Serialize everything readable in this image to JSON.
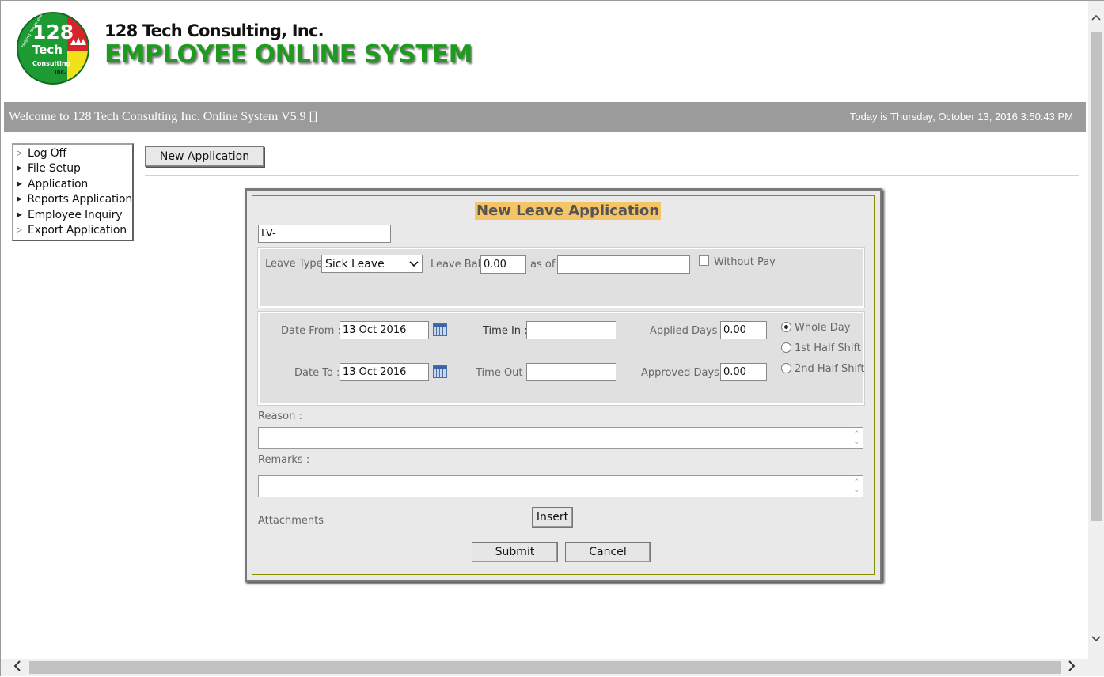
{
  "header": {
    "logo_text_main": "128",
    "logo_text_tech": "Tech",
    "logo_text_consulting": "Consulting",
    "logo_text_inc": "Inc.",
    "logo_tagline": "Helping You Innovate",
    "company_name": "128 Tech Consulting, Inc.",
    "system_name": "EMPLOYEE ONLINE SYSTEM"
  },
  "welcome_bar": {
    "welcome_text": "Welcome to 128 Tech Consulting Inc. Online System V5.9 []",
    "today_text": "Today is Thursday, October 13, 2016 3:50:43 PM"
  },
  "sidebar": {
    "items": [
      {
        "label": "Log Off",
        "marker": "▷"
      },
      {
        "label": "File Setup",
        "marker": "▶"
      },
      {
        "label": "Application",
        "marker": "▶"
      },
      {
        "label": "Reports Application",
        "marker": "▶"
      },
      {
        "label": "Employee Inquiry",
        "marker": "▶"
      },
      {
        "label": "Export Application",
        "marker": "▷"
      }
    ]
  },
  "toolbar": {
    "new_application_label": "New Application"
  },
  "form": {
    "title": "New Leave Application",
    "application_no": "LV-",
    "leave_type_label": "Leave Type",
    "leave_type_value": "Sick Leave",
    "leave_bal_label": "Leave Bal",
    "leave_bal_value": "0.00",
    "as_of_label": "as of",
    "as_of_value": "",
    "without_pay_label": "Without Pay",
    "date_from_label": "Date From :",
    "date_from_value": "13 Oct 2016",
    "date_to_label": "Date To :",
    "date_to_value": "13 Oct 2016",
    "time_in_label": "Time In :",
    "time_in_value": "",
    "time_out_label": "Time Out :",
    "time_out_value": "",
    "applied_days_label": "Applied Days :",
    "applied_days_value": "0.00",
    "approved_days_label": "Approved Days :",
    "approved_days_value": "0.00",
    "shift_options": [
      "Whole Day",
      "1st Half Shift",
      "2nd Half Shift"
    ],
    "reason_label": "Reason :",
    "remarks_label": "Remarks :",
    "attachments_label": "Attachments",
    "insert_label": "Insert",
    "submit_label": "Submit",
    "cancel_label": "Cancel"
  }
}
